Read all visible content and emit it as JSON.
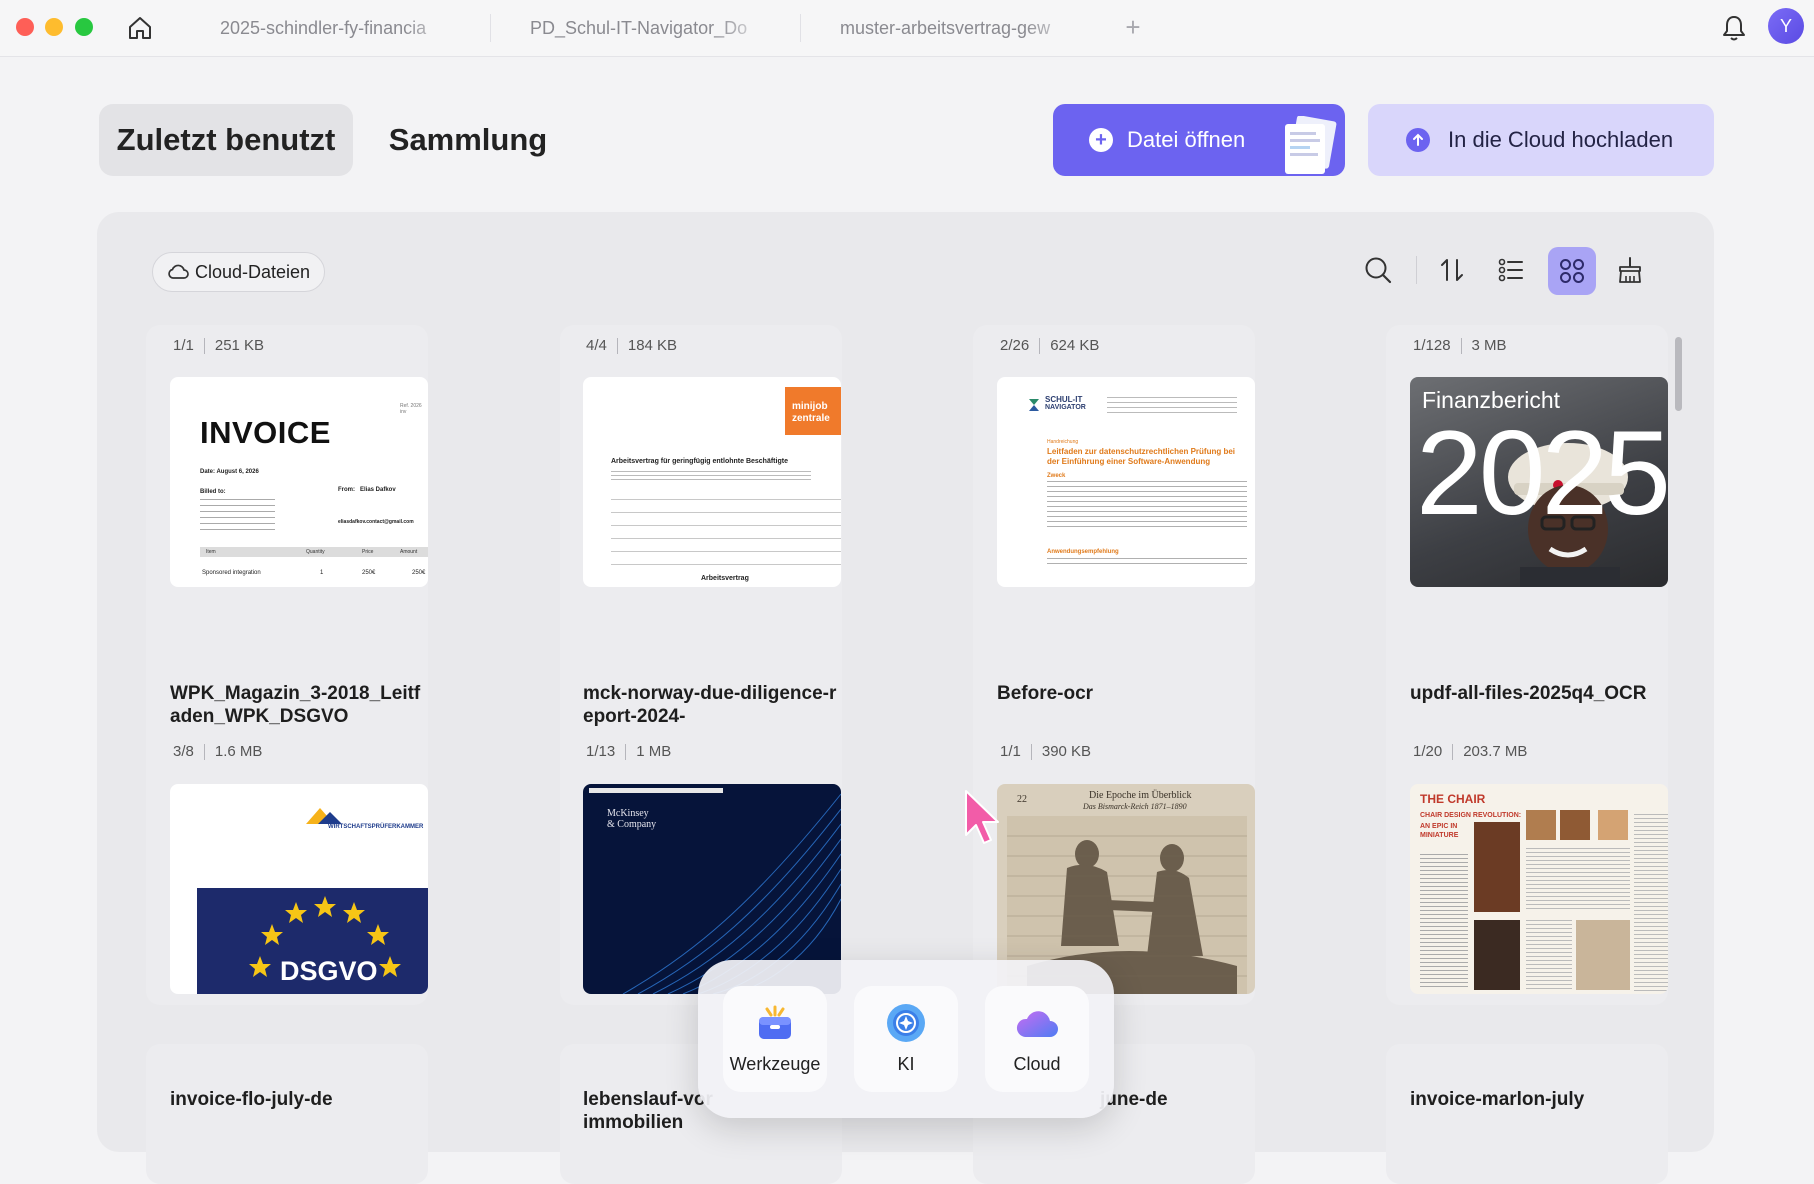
{
  "titlebar": {
    "tabs": [
      {
        "label": "2025-schindler-fy-financia"
      },
      {
        "label": "PD_Schul-IT-Navigator_Do"
      },
      {
        "label": "muster-arbeitsvertrag-gew"
      }
    ],
    "new_tab": "+",
    "avatar_letter": "Y"
  },
  "header": {
    "tab_recent": "Zuletzt benutzt",
    "tab_collection": "Sammlung",
    "open_file": "Datei öffnen",
    "upload_cloud": "In die Cloud hochladen"
  },
  "toolbar": {
    "cloud_files": "Cloud-Dateien"
  },
  "files": [
    {
      "pages": "1/1",
      "size": "251 KB",
      "thumb": "invoice"
    },
    {
      "pages": "4/4",
      "size": "184 KB",
      "thumb": "arbeitsvertrag"
    },
    {
      "pages": "2/26",
      "size": "624 KB",
      "thumb": "schul-it"
    },
    {
      "pages": "1/128",
      "size": "3 MB",
      "thumb": "finanzbericht"
    },
    {
      "name": "WPK_Magazin_3-2018_Leitfaden_WPK_DSGVO",
      "pages": "3/8",
      "size": "1.6 MB",
      "thumb": "dsgvo"
    },
    {
      "name": "mck-norway-due-diligence-report-2024-",
      "pages": "1/13",
      "size": "1 MB",
      "thumb": "mckinsey"
    },
    {
      "name": "Before-ocr",
      "pages": "1/1",
      "size": "390 KB",
      "thumb": "epoche"
    },
    {
      "name": "updf-all-files-2025q4_OCR",
      "pages": "1/20",
      "size": "203.7 MB",
      "thumb": "chair"
    },
    {
      "name": "invoice-flo-july-de"
    },
    {
      "name": "lebenslauf-vor\nimmobilien"
    },
    {
      "name": "june-de"
    },
    {
      "name": "invoice-marlon-july"
    }
  ],
  "thumbs": {
    "invoice": {
      "title": "INVOICE",
      "date": "Date:  August 6, 2026",
      "billed": "Billed to:",
      "from": "From:",
      "from_name": "Elias Dafkov",
      "email": "eliasdafkov.contact@gmail.com",
      "cols": [
        "Item",
        "Quantity",
        "Price",
        "Amount"
      ],
      "row": [
        "Sponsored integration",
        "1",
        "250€",
        "250€"
      ]
    },
    "arbeitsvertrag": {
      "badge1": "minijob",
      "badge2": "zentrale",
      "heading": "Arbeitsvertrag für geringfügig entlohnte Beschäftigte",
      "footer": "Arbeitsvertrag"
    },
    "schul-it": {
      "logo1": "SCHUL-IT",
      "logo2": "NAVIGATOR",
      "kicker": "Handreichung",
      "title": "Leitfaden zur datenschutzrechtlichen Prüfung bei der Einführung einer Software-Anwendung",
      "sec1": "Zweck",
      "sec2": "Anwendungsempfehlung"
    },
    "finanzbericht": {
      "title": "Finanzbericht",
      "year": "2025"
    },
    "dsgvo": {
      "org": "WIRTSCHAFTSPRÜFERKAMMER",
      "word": "DSGVO"
    },
    "mckinsey": {
      "brand": "McKinsey\n& Company"
    },
    "epoche": {
      "page": "22",
      "title": "Die Epoche im Überblick",
      "subtitle": "Das Bismarck-Reich 1871–1890"
    },
    "chair": {
      "title": "THE CHAIR",
      "sub": "CHAIR DESIGN REVOLUTION:",
      "sub2": "AN EPIC IN MINIATURE"
    }
  },
  "dock": {
    "tools": "Werkzeuge",
    "ai": "KI",
    "cloud": "Cloud"
  },
  "colors": {
    "accent": "#6c63f0",
    "accent_soft": "#d9d6fb"
  }
}
